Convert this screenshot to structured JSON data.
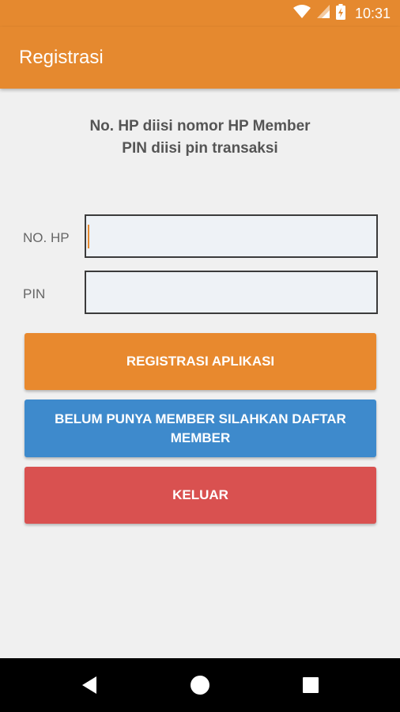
{
  "status_bar": {
    "time": "10:31",
    "icons": [
      "wifi-icon",
      "cell-signal-icon",
      "battery-charging-icon"
    ]
  },
  "app_bar": {
    "title": "Registrasi"
  },
  "instructions": {
    "line1": "No. HP diisi nomor HP Member",
    "line2": "PIN diisi pin transaksi"
  },
  "form": {
    "phone": {
      "label": "NO. HP",
      "value": "",
      "placeholder": ""
    },
    "pin": {
      "label": "PIN",
      "value": "",
      "placeholder": ""
    }
  },
  "buttons": {
    "register": "REGISTRASI APLIKASI",
    "member": "BELUM PUNYA MEMBER SILAHKAN DAFTAR MEMBER",
    "exit": "KELUAR"
  },
  "nav_bar": {
    "icons": [
      "back-icon",
      "home-icon",
      "recents-icon"
    ]
  },
  "colors": {
    "primary": "#e5892f",
    "register_button": "#e8892e",
    "member_button": "#3e8acc",
    "exit_button": "#d95150",
    "background": "#f0f0f0"
  }
}
